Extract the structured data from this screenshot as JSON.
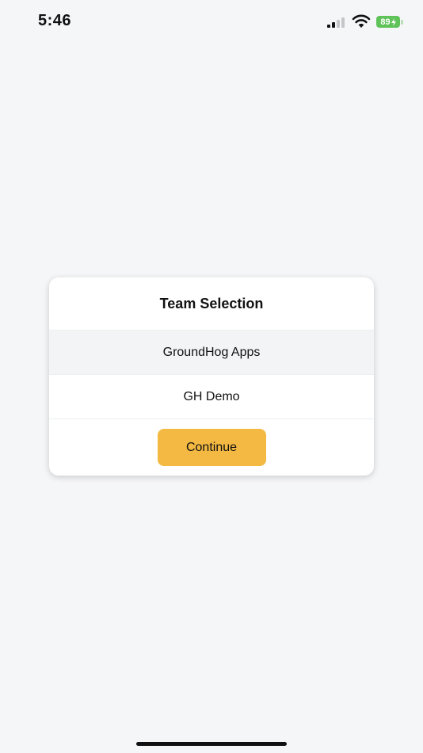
{
  "status_bar": {
    "time": "5:46",
    "battery": "89",
    "battery_color": "#5fc35a",
    "icons": [
      "signal-icon",
      "wifi-icon",
      "battery-icon",
      "bolt-icon"
    ]
  },
  "dialog": {
    "title": "Team Selection",
    "options": [
      {
        "label": "GroundHog Apps",
        "selected": true
      },
      {
        "label": "GH Demo",
        "selected": false
      }
    ],
    "continue_label": "Continue",
    "accent_color": "#f3b942"
  }
}
